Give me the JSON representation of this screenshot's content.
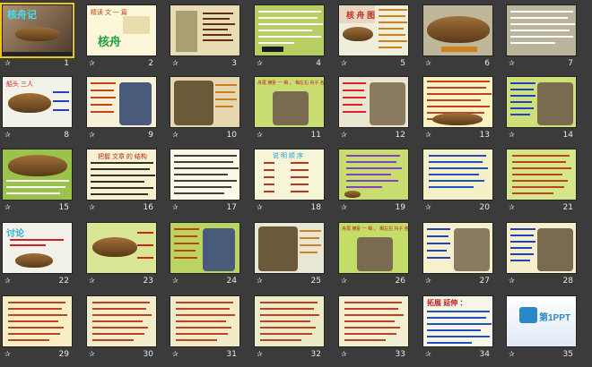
{
  "view": "slide-sorter",
  "icons": {
    "animation_marker": "star-icon"
  },
  "colors": {
    "background": "#3b3b3b",
    "selected_outline": "#f0c419"
  },
  "slides": [
    {
      "num": "1",
      "title": "核舟记"
    },
    {
      "num": "2",
      "title": "精读 文 一 篇",
      "text": "核舟"
    },
    {
      "num": "3",
      "title": ""
    },
    {
      "num": "4",
      "title": ""
    },
    {
      "num": "5",
      "title": "核 舟 图"
    },
    {
      "num": "6",
      "title": ""
    },
    {
      "num": "7",
      "title": ""
    },
    {
      "num": "8",
      "title": "船头 三人"
    },
    {
      "num": "9",
      "title": ""
    },
    {
      "num": "10",
      "title": ""
    },
    {
      "num": "11",
      "title": "舟尾 横卧 一 楫 ，  楫左右 舟子 各 一 人 。"
    },
    {
      "num": "12",
      "title": ""
    },
    {
      "num": "13",
      "title": ""
    },
    {
      "num": "14",
      "title": ""
    },
    {
      "num": "15",
      "title": ""
    },
    {
      "num": "16",
      "title": "把握 文章 的 结构"
    },
    {
      "num": "17",
      "title": ""
    },
    {
      "num": "18",
      "title": "说 明 顺 序"
    },
    {
      "num": "19",
      "title": ""
    },
    {
      "num": "20",
      "title": ""
    },
    {
      "num": "21",
      "title": ""
    },
    {
      "num": "22",
      "title": "讨论"
    },
    {
      "num": "23",
      "title": ""
    },
    {
      "num": "24",
      "title": ""
    },
    {
      "num": "25",
      "title": ""
    },
    {
      "num": "26",
      "title": "舟尾 横卧 一 楫 ，  楫左右 舟子 各 一 人 。"
    },
    {
      "num": "27",
      "title": ""
    },
    {
      "num": "28",
      "title": ""
    },
    {
      "num": "29",
      "title": ""
    },
    {
      "num": "30",
      "title": ""
    },
    {
      "num": "31",
      "title": ""
    },
    {
      "num": "32",
      "title": ""
    },
    {
      "num": "33",
      "title": ""
    },
    {
      "num": "34",
      "title": "拓展 延伸 ："
    },
    {
      "num": "35",
      "title": "第1PPT"
    }
  ]
}
